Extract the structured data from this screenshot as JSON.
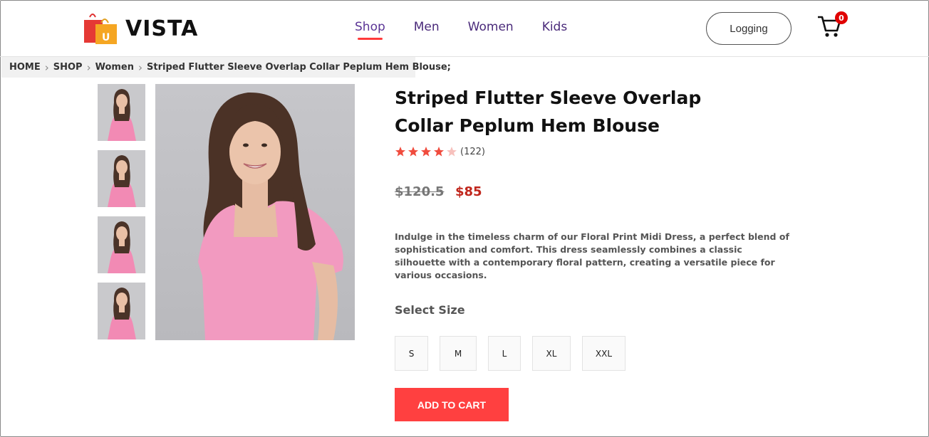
{
  "brand": {
    "name": "VISTA",
    "logo_icon": "shopping-bags-icon"
  },
  "nav": {
    "items": [
      "Shop",
      "Men",
      "Women",
      "Kids"
    ],
    "active": "Shop"
  },
  "header": {
    "login_label": "Logging",
    "cart_count": "0",
    "cart_icon": "cart-icon"
  },
  "breadcrumb": [
    "HOME",
    "SHOP",
    "Women",
    "Striped Flutter Sleeve Overlap Collar Peplum Hem Blouse;"
  ],
  "product": {
    "title": "Striped Flutter Sleeve Overlap Collar Peplum Hem Blouse",
    "rating": 4,
    "rating_max": 5,
    "reviews": "(122)",
    "price_old": "$120.5",
    "price_new": "$85",
    "description": "Indulge in the timeless charm of our Floral Print Midi Dress, a perfect blend of sophistication and comfort. This dress seamlessly combines a classic silhouette with a contemporary floral pattern, creating a versatile piece for various occasions.",
    "size_label": "Select Size",
    "sizes": [
      "S",
      "M",
      "L",
      "XL",
      "XXL"
    ],
    "add_to_cart": "ADD TO CART"
  },
  "colors": {
    "accent": "#ff4040",
    "price": "#c0261c",
    "nav": "#4a2a7a",
    "star": "#f04c3e",
    "star_empty": "#f7c1bd"
  }
}
